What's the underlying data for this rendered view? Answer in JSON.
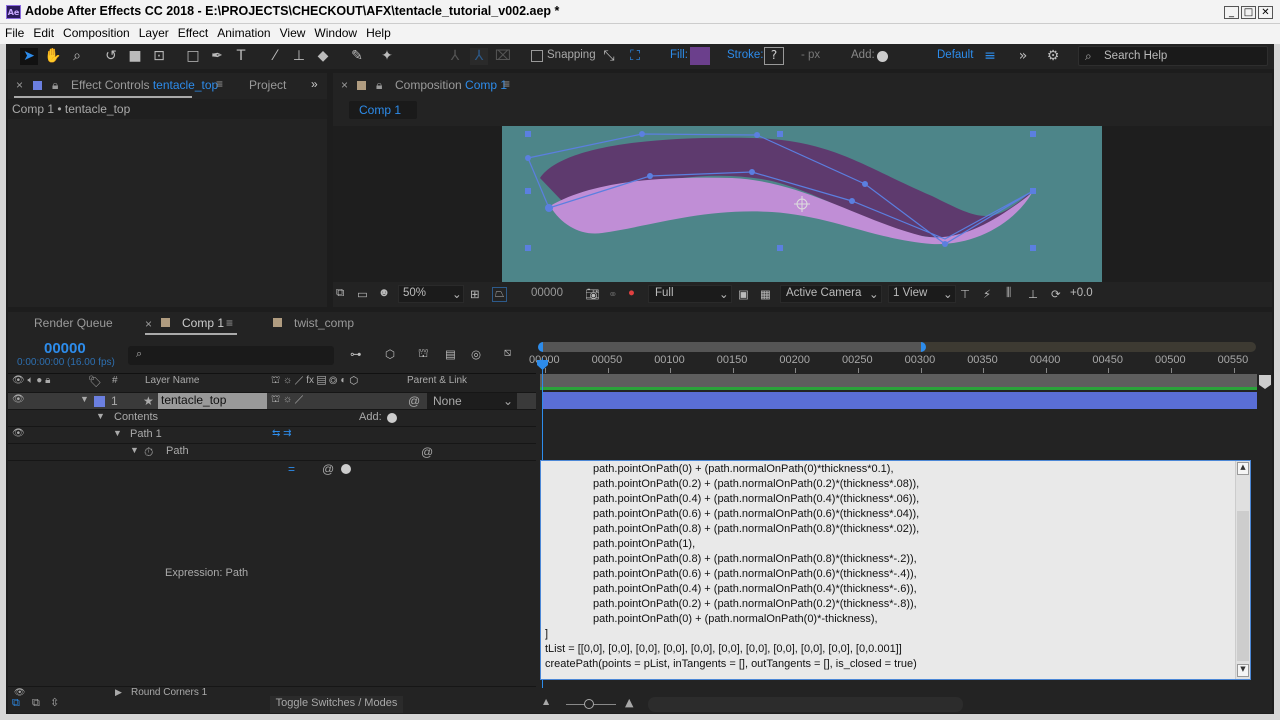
{
  "window": {
    "title": "Adobe After Effects CC 2018 - E:\\PROJECTS\\CHECKOUT\\AFX\\tentacle_tutorial_v002.aep *",
    "app_icon": "Ae"
  },
  "menu": [
    "File",
    "Edit",
    "Composition",
    "Layer",
    "Effect",
    "Animation",
    "View",
    "Window",
    "Help"
  ],
  "toolbar": {
    "snapping": "Snapping",
    "fill": "Fill:",
    "fill_color": "#6b3f8c",
    "stroke": "Stroke:",
    "stroke_value": "?",
    "px_label": "- px",
    "add": "Add:",
    "workspace": "Default",
    "search_placeholder": "Search Help"
  },
  "effect_panel": {
    "tab_prefix": "Effect Controls",
    "tab_layer": "tentacle_top",
    "project_tab": "Project",
    "breadcrumb": "Comp 1 • tentacle_top"
  },
  "comp_panel": {
    "tab_prefix": "Composition",
    "tab_comp": "Comp 1",
    "subtab": "Comp 1"
  },
  "viewer_bar": {
    "zoom": "50%",
    "timecode": "00000",
    "resolution": "Full",
    "camera": "Active Camera",
    "views": "1 View",
    "exposure": "+0.0"
  },
  "timeline": {
    "tabs": [
      {
        "label": "Render Queue"
      },
      {
        "label": "Comp 1"
      },
      {
        "label": "twist_comp"
      }
    ],
    "timecode": "00000",
    "timecode_sub": "0:00:00:00 (16.00 fps)",
    "columns": {
      "layer_name": "Layer Name",
      "num": "#",
      "parent": "Parent & Link"
    },
    "layer": {
      "index": "1",
      "name": "tentacle_top",
      "parent": "None"
    },
    "props": {
      "contents": "Contents",
      "add": "Add:",
      "path1": "Path 1",
      "path": "Path",
      "expression_label": "Expression: Path",
      "round_corners": "Round Corners 1"
    },
    "ruler": [
      "00000",
      "00050",
      "00100",
      "00150",
      "00200",
      "00250",
      "00300",
      "00350",
      "00400",
      "00450",
      "00500",
      "00550"
    ],
    "work_area_end_fraction": 0.54,
    "toggle": "Toggle Switches / Modes"
  },
  "expression": {
    "lines": [
      "path.pointOnPath(0) + (path.normalOnPath(0)*thickness*0.1),",
      "path.pointOnPath(0.2) + (path.normalOnPath(0.2)*(thickness*.08)),",
      "path.pointOnPath(0.4) + (path.normalOnPath(0.4)*(thickness*.06)),",
      "path.pointOnPath(0.6) + (path.normalOnPath(0.6)*(thickness*.04)),",
      "path.pointOnPath(0.8) + (path.normalOnPath(0.8)*(thickness*.02)),",
      "path.pointOnPath(1),",
      "path.pointOnPath(0.8) + (path.normalOnPath(0.8)*(thickness*-.2)),",
      "path.pointOnPath(0.6) + (path.normalOnPath(0.6)*(thickness*-.4)),",
      "path.pointOnPath(0.4) + (path.normalOnPath(0.4)*(thickness*-.6)),",
      "path.pointOnPath(0.2) + (path.normalOnPath(0.2)*(thickness*-.8)),",
      "path.pointOnPath(0) + (path.normalOnPath(0)*-thickness),",
      "]",
      "tList = [[0,0], [0,0], [0,0], [0,0], [0,0], [0,0], [0,0], [0,0], [0,0], [0,0], [0,0.001]]",
      "createPath(points = pList, inTangents = [], outTangents = [], is_closed = true)"
    ]
  }
}
